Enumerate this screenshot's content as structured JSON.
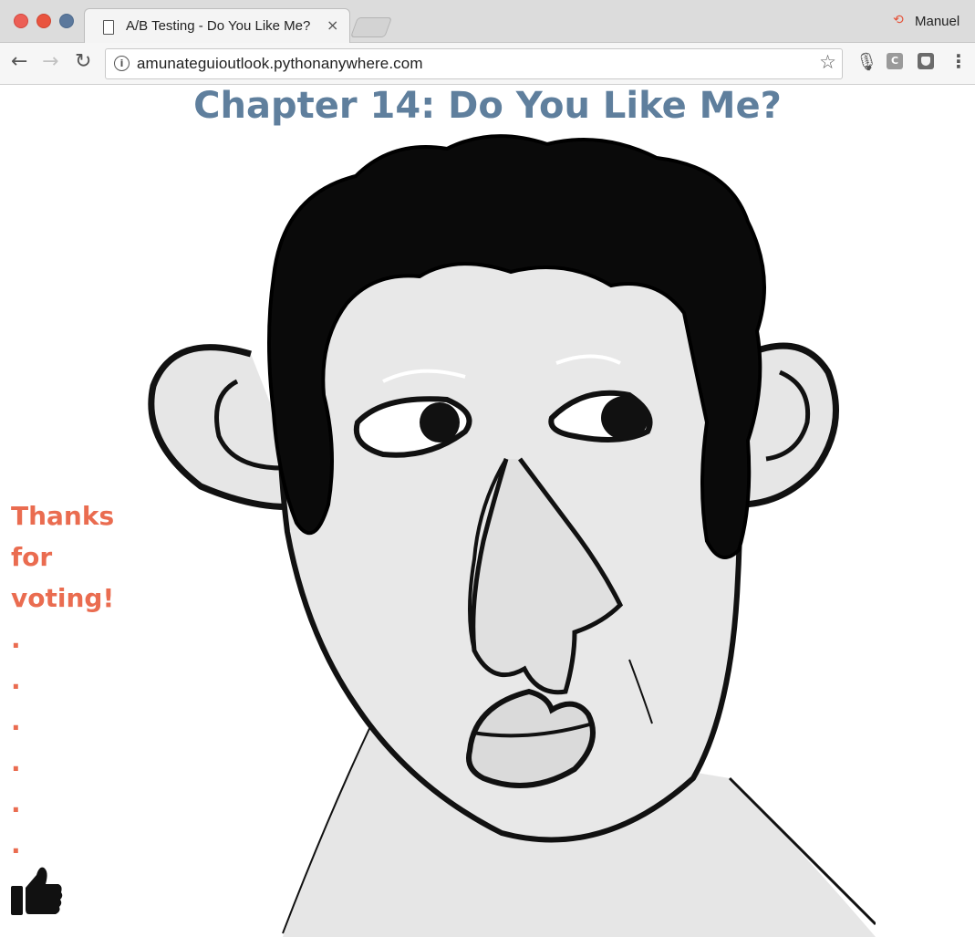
{
  "browser": {
    "tab_title": "A/B Testing - Do You Like Me?",
    "tab_close_glyph": "×",
    "profile_name": "Manuel",
    "url": "amunateguioutlook.pythonanywhere.com",
    "nav": {
      "back_glyph": "←",
      "forward_glyph": "→",
      "reload_glyph": "↻"
    },
    "icons": [
      "document-icon",
      "close-icon",
      "profile-icon",
      "info-icon",
      "star-icon",
      "microphone-icon",
      "extension-icon",
      "menu-icon"
    ]
  },
  "page": {
    "title": "Chapter 14: Do You Like Me?",
    "thanks_lines": [
      "Thanks",
      "for",
      "voting!"
    ],
    "dots": [
      ".",
      ".",
      ".",
      ".",
      ".",
      "."
    ],
    "colors": {
      "title": "#5f7f9d",
      "thanks": "#ea6c50"
    }
  }
}
